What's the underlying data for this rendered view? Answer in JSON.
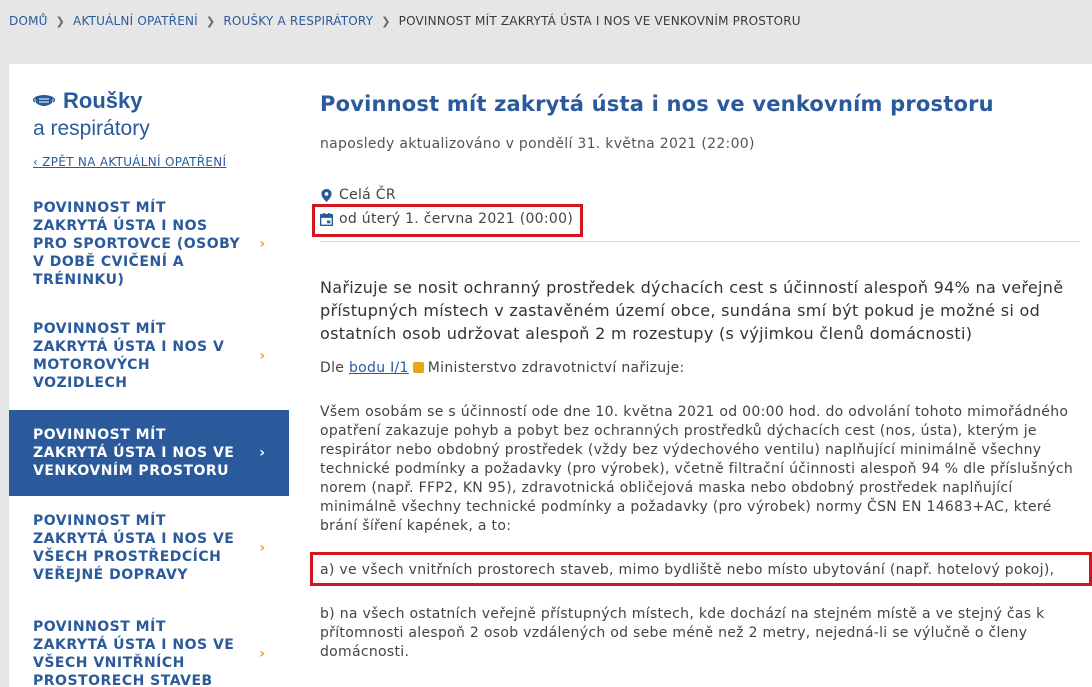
{
  "breadcrumb": {
    "items": [
      "DOMŮ",
      "AKTUÁLNÍ OPATŘENÍ",
      "ROUŠKY A RESPIRÁTORY"
    ],
    "current": "POVINNOST MÍT ZAKRYTÁ ÚSTA I NOS VE VENKOVNÍM PROSTORU"
  },
  "sidebar": {
    "title_line1": "Roušky",
    "title_line2": "a respirátory",
    "back_link": "ZPĚT NA AKTUÁLNÍ OPATŘENÍ",
    "items": [
      {
        "label": "POVINNOST MÍT ZAKRYTÁ ÚSTA I NOS PRO SPORTOVCE (OSOBY V DOBĚ CVIČENÍ A TRÉNINKU)"
      },
      {
        "label": "POVINNOST MÍT ZAKRYTÁ ÚSTA I NOS V MOTOROVÝCH VOZIDLECH"
      },
      {
        "label": "POVINNOST MÍT ZAKRYTÁ ÚSTA I NOS VE VENKOVNÍM PROSTORU",
        "active": true
      },
      {
        "label": "POVINNOST MÍT ZAKRYTÁ ÚSTA I NOS VE VŠECH PROSTŘEDCÍCH VEŘEJNÉ DOPRAVY"
      },
      {
        "label": "POVINNOST MÍT ZAKRYTÁ ÚSTA I NOS VE VŠECH VNITŘNÍCH PROSTORECH STAVEB"
      }
    ]
  },
  "main": {
    "title": "Povinnost mít zakrytá ústa i nos ve venkovním prostoru",
    "updated": "naposledy aktualizováno v pondělí 31. května 2021 (22:00)",
    "location": "Celá ČR",
    "valid_from": "od úterý 1. června 2021 (00:00)",
    "lead": "Nařizuje se nosit ochranný prostředek dýchacích cest s účinností alespoň 94% na veřejně přístupných místech v zastavěném území obce, sundána smí být pokud je možné si od ostatních osob udržovat alespoň 2 m rozestupy (s výjimkou členů domácnosti)",
    "basis_prefix": "Dle",
    "basis_link": "bodu I/1",
    "basis_suffix": "Ministerstvo zdravotnictví nařizuje:",
    "body": "Všem osobám se s účinností ode dne 10. května 2021 od 00:00 hod. do odvolání tohoto mimořádného opatření zakazuje pohyb a pobyt bez ochranných prostředků dýchacích cest (nos, ústa), kterým je respirátor nebo obdobný prostředek (vždy bez výdechového ventilu) naplňující minimálně všechny technické podmínky a požadavky (pro výrobek), včetně filtrační účinnosti alespoň 94 % dle příslušných norem (např. FFP2, KN 95), zdravotnická obličejová maska nebo obdobný prostředek naplňující minimálně všechny technické podmínky a požadavky (pro výrobek) normy ČSN EN 14683+AC, které brání šíření kapének, a to:",
    "item_a": "a) ve všech vnitřních prostorech staveb, mimo bydliště nebo místo ubytování (např. hotelový pokoj),",
    "item_b": "b) na všech ostatních veřejně přístupných místech, kde dochází na stejném místě a ve stejný čas k přítomnosti alespoň 2 osob vzdálených od sebe méně než 2 metry, nejedná-li se výlučně o členy domácnosti."
  },
  "colors": {
    "brand_blue": "#2a5a9c",
    "accent_yellow": "#e7a61a",
    "highlight_red": "#d0161f"
  }
}
